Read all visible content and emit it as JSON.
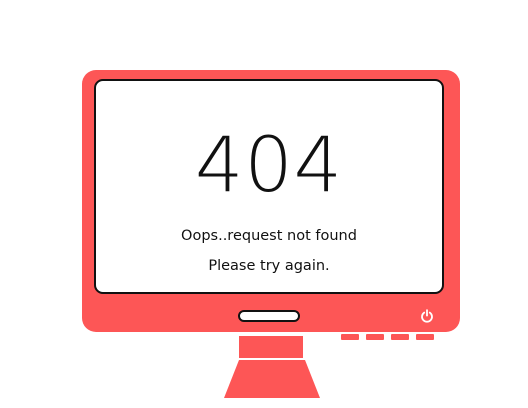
{
  "error": {
    "code": "404",
    "message": "Oops..request not found",
    "hint": "Please try again."
  },
  "monitor": {
    "accent_color": "#fd5656",
    "outline_color": "#111111",
    "power_icon": "power-icon",
    "port_count": 4
  }
}
